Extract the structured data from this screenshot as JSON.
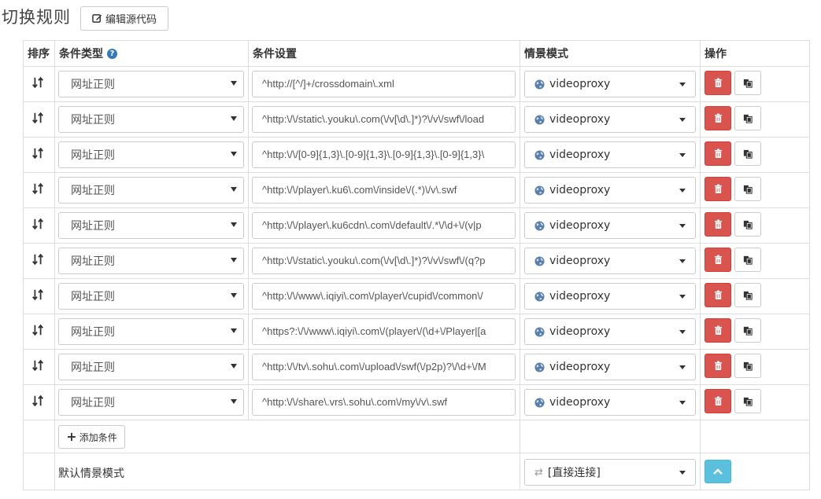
{
  "header": {
    "title": "切换规则",
    "edit_source_label": "编辑源代码"
  },
  "table": {
    "columns": {
      "sort": "排序",
      "condition_type": "条件类型",
      "condition_setting": "条件设置",
      "profile": "情景模式",
      "actions": "操作"
    },
    "rows": [
      {
        "type": "网址正则",
        "pattern": "^http://[^/]+/crossdomain\\.xml",
        "profile": "videoproxy"
      },
      {
        "type": "网址正则",
        "pattern": "^http:\\/\\/static\\.youku\\.com(\\/v[\\d\\.]*)?\\/v\\/swf\\/load",
        "profile": "videoproxy"
      },
      {
        "type": "网址正则",
        "pattern": "^http:\\/\\/[0-9]{1,3}\\.[0-9]{1,3}\\.[0-9]{1,3}\\.[0-9]{1,3}\\",
        "profile": "videoproxy"
      },
      {
        "type": "网址正则",
        "pattern": "^http:\\/\\/player\\.ku6\\.com\\/inside\\/(.*)\\/v\\.swf",
        "profile": "videoproxy"
      },
      {
        "type": "网址正则",
        "pattern": "^http:\\/\\/player\\.ku6cdn\\.com\\/default\\/.*\\/\\d+\\/(v|p",
        "profile": "videoproxy"
      },
      {
        "type": "网址正则",
        "pattern": "^http:\\/\\/static\\.youku\\.com(\\/v[\\d\\.]*)?\\/v\\/swf\\/(q?p",
        "profile": "videoproxy"
      },
      {
        "type": "网址正则",
        "pattern": "^http:\\/\\/www\\.iqiyi\\.com\\/player\\/cupid\\/common\\/",
        "profile": "videoproxy"
      },
      {
        "type": "网址正则",
        "pattern": "^https?:\\/\\/www\\.iqiyi\\.com\\/(player\\/(\\d+\\/Player|[a",
        "profile": "videoproxy"
      },
      {
        "type": "网址正则",
        "pattern": "^http:\\/\\/tv\\.sohu\\.com\\/upload\\/swf(\\/p2p)?\\/\\d+\\/M",
        "profile": "videoproxy"
      },
      {
        "type": "网址正则",
        "pattern": "^http:\\/\\/share\\.vrs\\.sohu\\.com\\/my\\/v\\.swf",
        "profile": "videoproxy"
      }
    ],
    "add_condition_label": "添加条件",
    "default_profile_label": "默认情景模式",
    "default_profile_value": "[直接连接]"
  },
  "colors": {
    "danger": "#d9534f",
    "info": "#5bc0de",
    "primary": "#337ab7",
    "border": "#dddddd"
  }
}
